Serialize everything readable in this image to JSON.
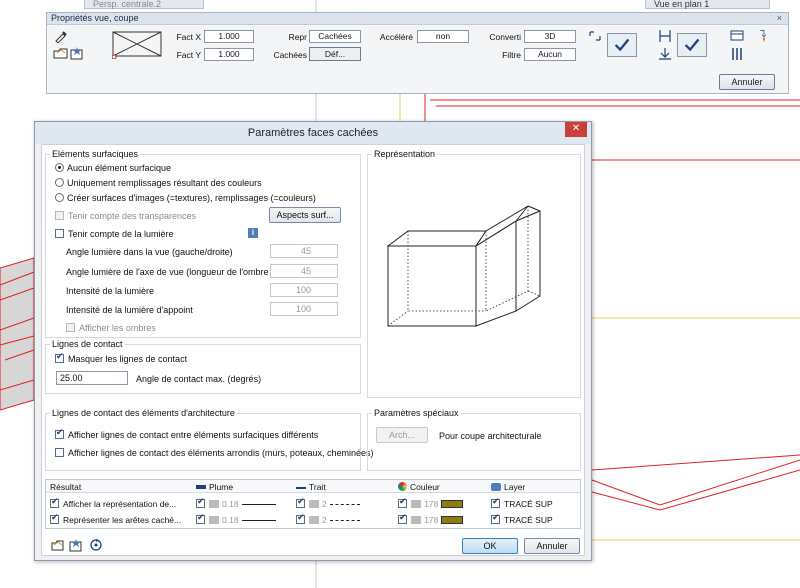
{
  "background": {
    "tab_left": "Persp. centrale.2",
    "tab_right": "Vue en plan 1"
  },
  "propbar": {
    "title": "Propriétés vue, coupe",
    "close": "×",
    "fact_x_label": "Fact X",
    "fact_x_value": "1.000",
    "fact_y_label": "Fact Y",
    "fact_y_value": "1.000",
    "repr_label": "Repr",
    "repr_value": "Cachées",
    "cachees_label": "Cachées",
    "cachees_value": "Déf...",
    "accelere_label": "Accéléré",
    "accelere_value": "non",
    "converti_label": "Converti",
    "converti_value": "3D",
    "filtre_label": "Filtre",
    "filtre_value": "Aucun",
    "annuler": "Annuler"
  },
  "dialog": {
    "title": "Paramètres faces cachées",
    "close": "✕",
    "surface_group": {
      "title": "Eléments surfaciques",
      "options": [
        "Aucun élément surfacique",
        "Uniquement remplissages résultant des couleurs",
        "Créer surfaces d'images (=textures), remplissages (=couleurs)"
      ],
      "selected": 0,
      "transparences": "Tenir compte des transparences",
      "aspects_button": "Aspects surf...",
      "lumiere": "Tenir compte de la lumière",
      "angle_vue_label": "Angle lumière dans la vue (gauche/droite)",
      "angle_vue_value": "45",
      "angle_axe_label": "Angle lumière de l'axe de vue (longueur de l'ombre",
      "angle_axe_value": "45",
      "intensite_label": "Intensité de la lumière",
      "intensite_value": "100",
      "intensite_appoint_label": "Intensité de la lumière d'appoint",
      "intensite_appoint_value": "100",
      "ombres": "Afficher les ombres"
    },
    "representation": {
      "title": "Représentation"
    },
    "contact_group": {
      "title": "Lignes de contact",
      "masquer": "Masquer les lignes de contact",
      "angle_value": "25.00",
      "angle_label": "Angle de contact max. (degrés)"
    },
    "archi_group": {
      "title": "Lignes de contact des éléments d'architecture",
      "opt1": "Afficher lignes de contact entre éléments surfaciques différents",
      "opt2": "Afficher lignes de contact des éléments arrondis (murs, poteaux, cheminées)"
    },
    "special_group": {
      "title": "Paramètres spéciaux",
      "arch_button": "Arch...",
      "arch_label": "Pour coupe architecturale"
    },
    "result_table": {
      "headers": [
        "Résultat",
        "Plume",
        "Trait",
        "Couleur",
        "Layer"
      ],
      "rows": [
        {
          "label": "Afficher la représentation de...",
          "plume": "0.18",
          "trait": "2",
          "couleur": "178",
          "layer": "TRACÉ SUP"
        },
        {
          "label": "Représenter les arêtes caché...",
          "plume": "0.18",
          "trait": "2",
          "couleur": "178",
          "layer": "TRACÉ SUP"
        }
      ]
    },
    "ok": "OK",
    "annuler": "Annuler"
  },
  "colors": {
    "cad_red": "#e02020",
    "cad_yellow": "#e8d04a",
    "title_bg": "#dfe7f1",
    "close_red": "#c7403a",
    "ok_blue": "#bfdcf3",
    "layer_color": "#8c7a12"
  }
}
